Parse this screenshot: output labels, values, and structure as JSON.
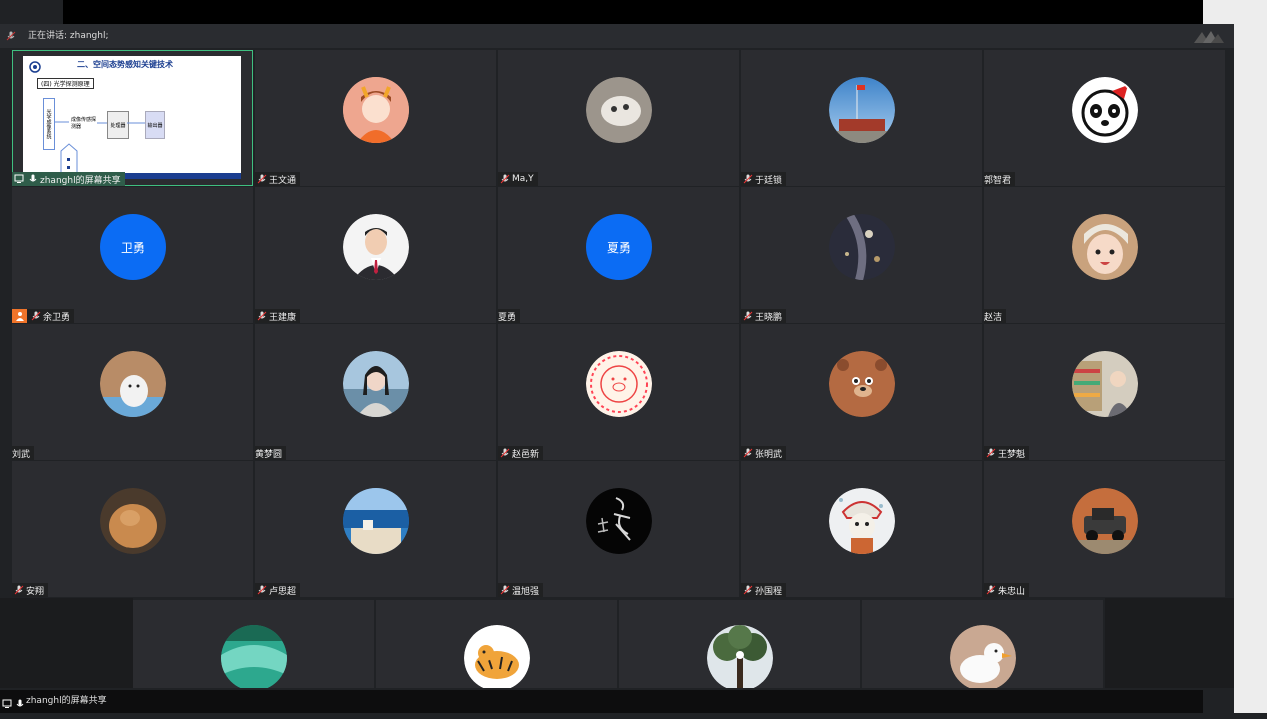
{
  "speaking": {
    "text": "正在讲话: zhanghl;"
  },
  "share": {
    "tile_label": "zhanghl的屏幕共享",
    "slide_title": "二、空间态势感知关键技术",
    "slide_subtitle": "(四) 光学探测原理",
    "slide_box1": "成像传感探测器",
    "slide_box2": "处理器",
    "slide_box3": "输出器",
    "slide_vertical": "光学成像系统"
  },
  "avatar_text": {
    "wei": "卫勇",
    "xia": "夏勇"
  },
  "participants": [
    {
      "name": "王文通",
      "muted": true
    },
    {
      "name": "Ma,Y",
      "muted": true
    },
    {
      "name": "于廷锁",
      "muted": true
    },
    {
      "name": "郭智君",
      "muted": false
    },
    {
      "name": "余卫勇",
      "muted": true
    },
    {
      "name": "王建康",
      "muted": true
    },
    {
      "name": "夏勇",
      "muted": false
    },
    {
      "name": "王晓鹏",
      "muted": true
    },
    {
      "name": "赵洁",
      "muted": false
    },
    {
      "name": "刘武",
      "muted": false
    },
    {
      "name": "黄梦圆",
      "muted": false
    },
    {
      "name": "赵邑新",
      "muted": true
    },
    {
      "name": "张明武",
      "muted": true
    },
    {
      "name": "王梦魁",
      "muted": true
    },
    {
      "name": "安翔",
      "muted": true
    },
    {
      "name": "卢思超",
      "muted": true
    },
    {
      "name": "温旭强",
      "muted": true
    },
    {
      "name": "孙国程",
      "muted": true
    },
    {
      "name": "朱忠山",
      "muted": true
    }
  ],
  "bottom": {
    "text": "zhanghl的屏幕共享"
  }
}
